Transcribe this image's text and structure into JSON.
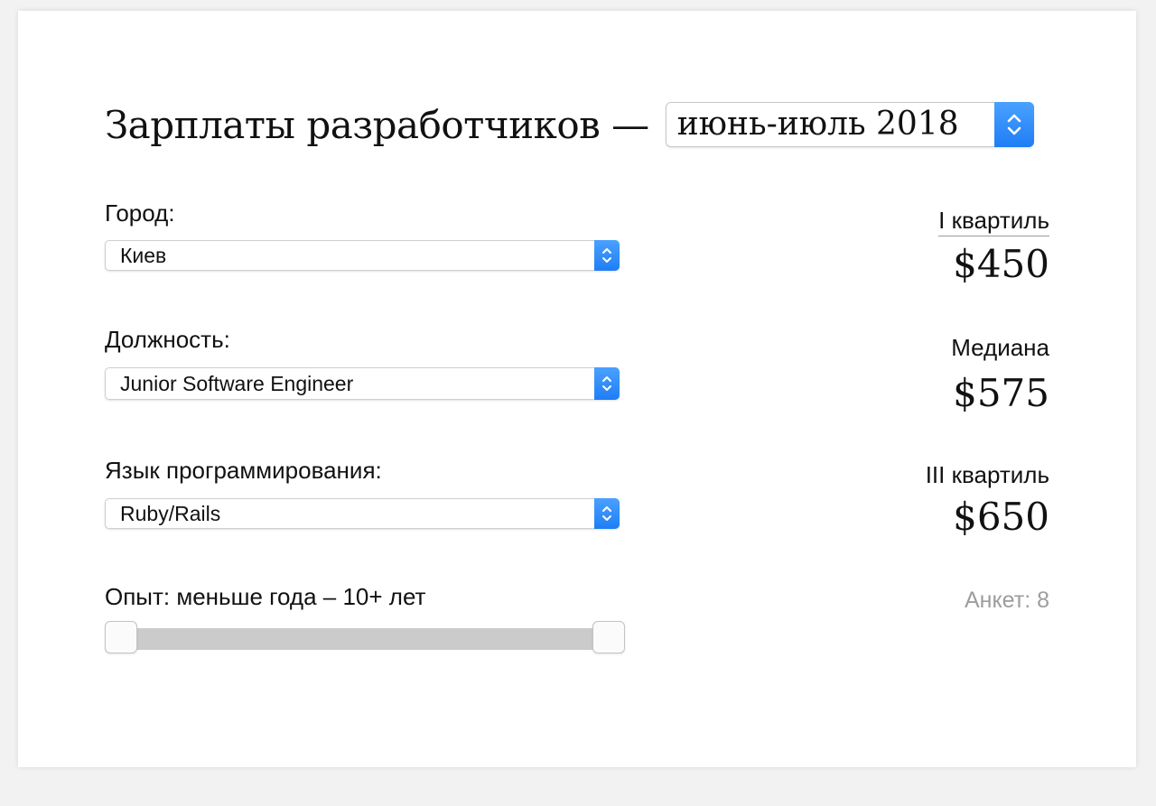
{
  "header": {
    "title": "Зарплаты разработчиков —",
    "period_selected": "июнь-июль 2018"
  },
  "filters": {
    "city": {
      "label": "Город:",
      "selected": "Киев"
    },
    "position": {
      "label": "Должность:",
      "selected": "Junior Software Engineer"
    },
    "language": {
      "label": "Язык программирования:",
      "selected": "Ruby/Rails"
    },
    "experience": {
      "label": "Опыт: меньше года – 10+ лет",
      "range_min_fraction": 0.0,
      "range_max_fraction": 1.0
    }
  },
  "stats": {
    "q1": {
      "label": "I квартиль",
      "value": "$450"
    },
    "median": {
      "label": "Медиана",
      "value": "$575"
    },
    "q3": {
      "label": "III квартиль",
      "value": "$650"
    },
    "count": "Анкет: 8"
  },
  "colors": {
    "accent": "#1f7ef6",
    "muted_text": "#9d9d9d",
    "track": "#cbcbcb"
  },
  "icons": {
    "select_arrows": "chevron-up-down-icon"
  }
}
